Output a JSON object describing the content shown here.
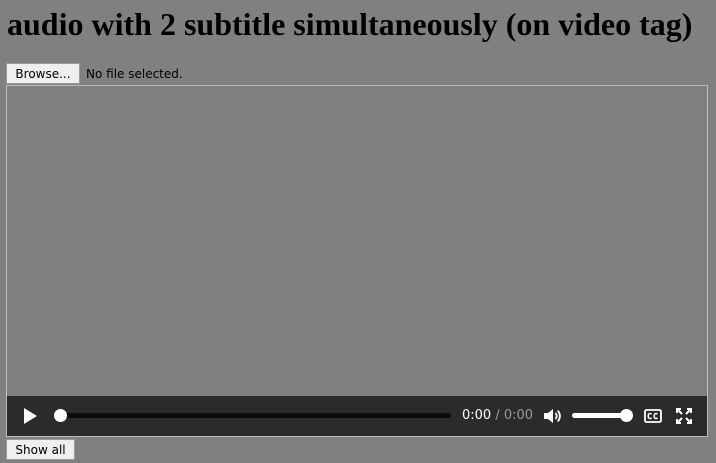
{
  "page": {
    "title": "audio with 2 subtitle simultaneously (on video tag)"
  },
  "file_input": {
    "button_label": "Browse...",
    "status": "No file selected."
  },
  "video": {
    "current_time": "0:00",
    "separator": "/",
    "duration": "0:00",
    "progress": 0,
    "volume": 1.0,
    "icons": {
      "play": "play-icon",
      "volume": "volume-icon",
      "captions": "closed-captions-icon",
      "fullscreen": "fullscreen-icon"
    }
  },
  "show_all": {
    "label": "Show all"
  },
  "colors": {
    "page_background": "#808080",
    "controls_background": "#2b2b2b",
    "button_background": "#efefef"
  }
}
